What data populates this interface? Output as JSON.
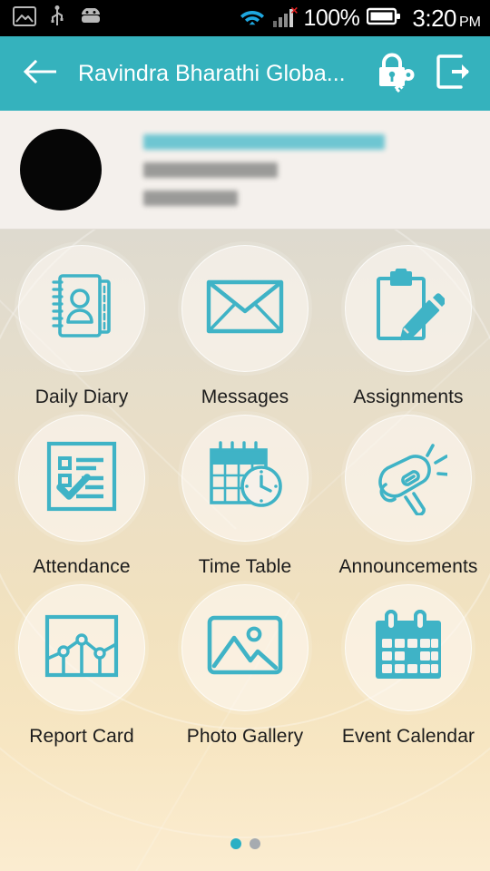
{
  "status_bar": {
    "left_icons": [
      "image-icon",
      "usb-icon",
      "android-robot-icon"
    ],
    "wifi_icon": "wifi-icon",
    "signal_icon": "signal-bars-icon",
    "signal_error_mark": "×",
    "battery_percent": "100%",
    "battery_icon": "battery-full-icon",
    "time": "3:20",
    "ampm": "PM"
  },
  "toolbar": {
    "back_icon": "back-arrow-icon",
    "title": "Ravindra Bharathi Globa...",
    "change_password_icon": "lock-key-icon",
    "logout_icon": "logout-icon",
    "background_color": "#35b2bd"
  },
  "profile": {
    "avatar": "avatar",
    "name_redacted": "",
    "class_redacted": "",
    "section_redacted": ""
  },
  "grid": {
    "items": [
      {
        "label": "Daily Diary",
        "icon": "notebook-person-icon"
      },
      {
        "label": "Messages",
        "icon": "envelope-icon"
      },
      {
        "label": "Assignments",
        "icon": "clipboard-pencil-icon"
      },
      {
        "label": "Attendance",
        "icon": "checklist-check-icon"
      },
      {
        "label": "Time Table",
        "icon": "calendar-clock-icon"
      },
      {
        "label": "Announcements",
        "icon": "megaphone-icon"
      },
      {
        "label": "Report Card",
        "icon": "chart-graph-icon"
      },
      {
        "label": "Photo Gallery",
        "icon": "photo-image-icon"
      },
      {
        "label": "Event Calendar",
        "icon": "calendar-filled-icon"
      }
    ]
  },
  "pager": {
    "total": 2,
    "active_index": 0,
    "active_color": "#2ab0c4",
    "inactive_color": "#a6abb0"
  },
  "theme": {
    "accent": "#35b2bd",
    "icon_color": "#3fb3c6",
    "label_color": "#1c1c1c",
    "profile_bg": "#f4f0ec"
  }
}
